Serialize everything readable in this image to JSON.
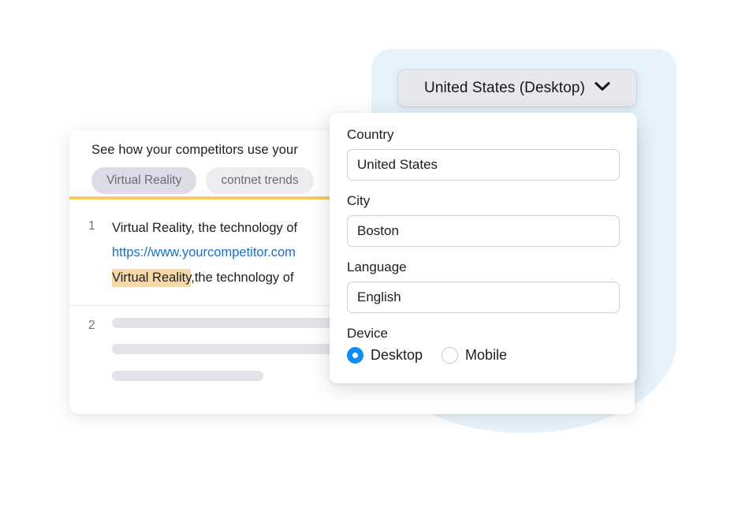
{
  "decor": {
    "blob_color": "#d9ecf7"
  },
  "results_card": {
    "headline": "See how your competitors use your",
    "tabs": [
      {
        "label": "Virtual Reality",
        "selected": true
      },
      {
        "label": "contnet trends",
        "selected": false
      }
    ],
    "divider_color": "#f5cb5f",
    "results": [
      {
        "rank": "1",
        "title": "Virtual Reality, the technology of",
        "url": "https://www.yourcompetitor.com",
        "snippet_highlight": "Virtual Reality",
        "snippet_rest": ",the technology of",
        "highlight_color": "#f8d9a3",
        "link_color": "#1c6fc4"
      },
      {
        "rank": "2",
        "title": "",
        "url": "",
        "snippet_highlight": "",
        "snippet_rest": ""
      }
    ]
  },
  "dropdown_button": {
    "label": "United States (Desktop)",
    "icon": "chevron-down-icon"
  },
  "dropdown_panel": {
    "fields": [
      {
        "label": "Country",
        "value": "United States",
        "placeholder": "Country"
      },
      {
        "label": "City",
        "value": "Boston",
        "placeholder": "City"
      },
      {
        "label": "Language",
        "value": "English",
        "placeholder": "Language"
      }
    ],
    "device": {
      "label": "Device",
      "accent_color": "#128cf0",
      "options": [
        {
          "label": "Desktop",
          "selected": true
        },
        {
          "label": "Mobile",
          "selected": false
        }
      ]
    }
  }
}
